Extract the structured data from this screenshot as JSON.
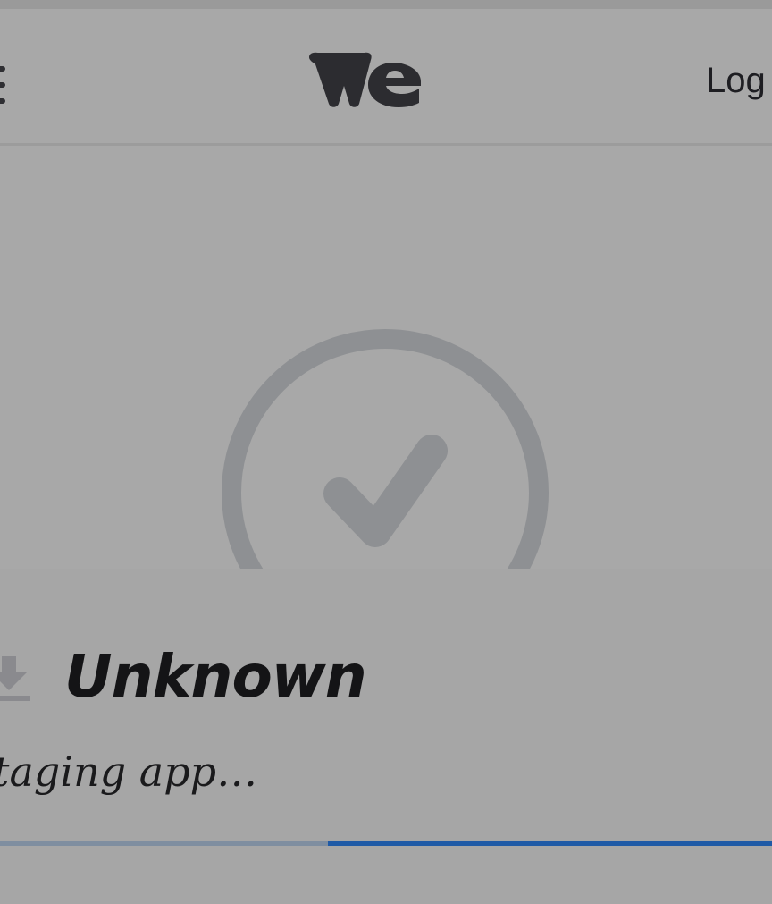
{
  "header": {
    "menu_icon": "hamburger-menu-icon",
    "logo_icon": "we-logo-icon",
    "login_label": "Log"
  },
  "status": {
    "check_icon": "success-check-icon"
  },
  "sheet": {
    "download_icon": "download-icon",
    "file_name": "Unknown",
    "status_text": "taging app…",
    "progress_fraction": 0.425
  },
  "colors": {
    "overlay_gray": "#a8a8a8",
    "icon_gray": "#8e9093",
    "text_dark": "#141416",
    "progress_blue": "#1f5aa6"
  }
}
